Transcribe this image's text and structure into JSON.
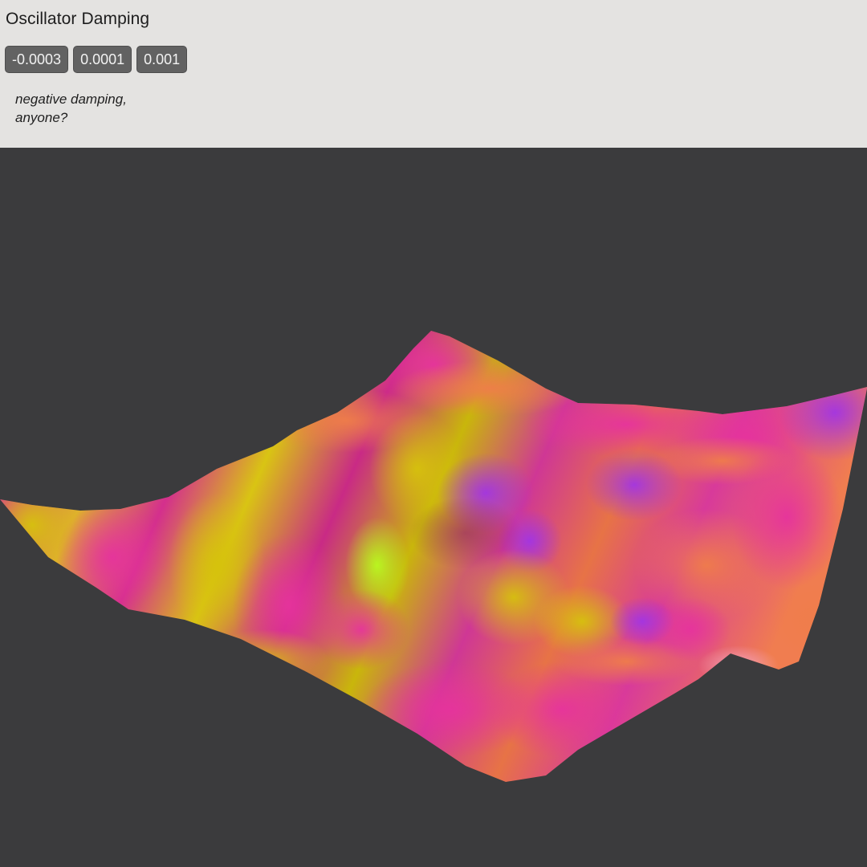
{
  "panel": {
    "title": "Oscillator Damping",
    "buttons": [
      {
        "label": "-0.0003"
      },
      {
        "label": "0.0001"
      },
      {
        "label": "0.001"
      }
    ],
    "note_line1": "negative damping,",
    "note_line2": "anyone?"
  },
  "colors": {
    "panel_bg": "#e4e3e1",
    "viewport_bg": "#3b3b3d",
    "button_bg": "#626262",
    "surface_magenta": "#e0359a",
    "surface_yellow": "#d2c10c",
    "surface_orange": "#f07c4a",
    "surface_violet": "#b63ad8",
    "surface_lime": "#b8f21c"
  }
}
